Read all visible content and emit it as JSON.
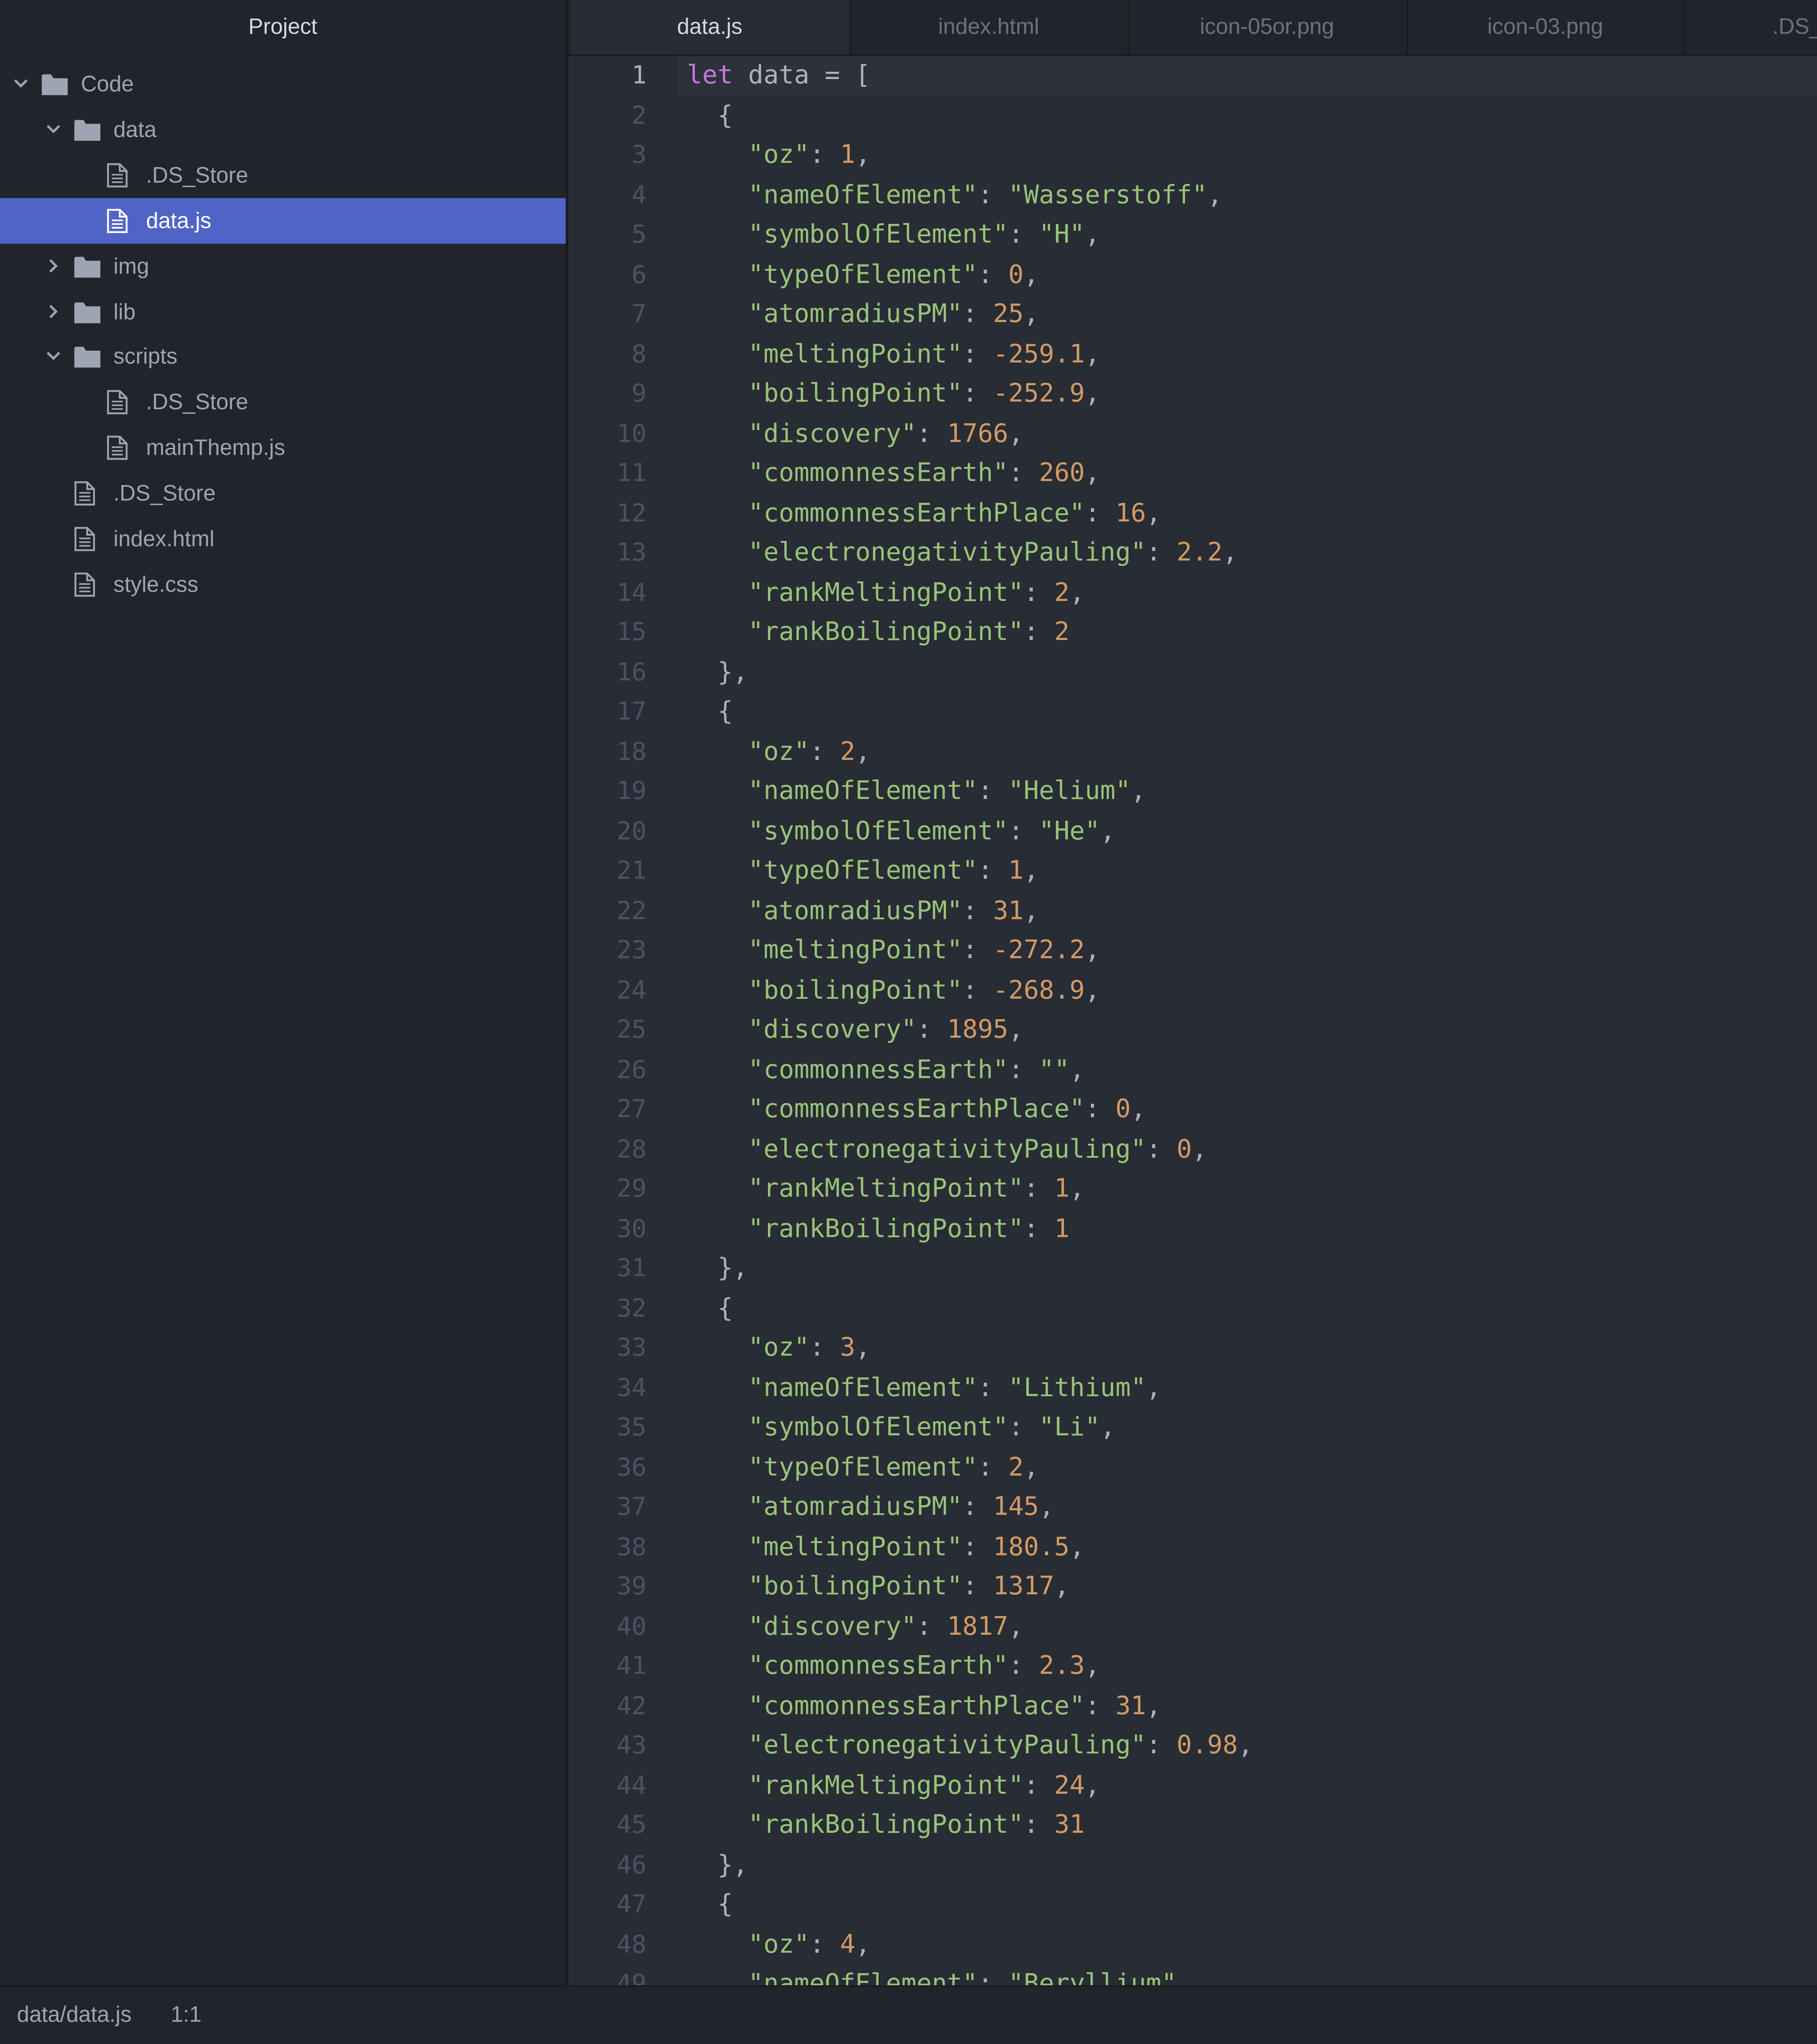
{
  "sidebar": {
    "title": "Project",
    "items": [
      {
        "label": "Code",
        "type": "folder",
        "depth": 0,
        "expanded": true,
        "selected": false
      },
      {
        "label": "data",
        "type": "folder",
        "depth": 1,
        "expanded": true,
        "selected": false
      },
      {
        "label": ".DS_Store",
        "type": "file",
        "depth": 2,
        "selected": false
      },
      {
        "label": "data.js",
        "type": "file",
        "depth": 2,
        "selected": true
      },
      {
        "label": "img",
        "type": "folder",
        "depth": 1,
        "expanded": false,
        "selected": false
      },
      {
        "label": "lib",
        "type": "folder",
        "depth": 1,
        "expanded": false,
        "selected": false
      },
      {
        "label": "scripts",
        "type": "folder",
        "depth": 1,
        "expanded": true,
        "selected": false
      },
      {
        "label": ".DS_Store",
        "type": "file",
        "depth": 2,
        "selected": false
      },
      {
        "label": "mainThemp.js",
        "type": "file",
        "depth": 2,
        "selected": false
      },
      {
        "label": ".DS_Store",
        "type": "file",
        "depth": 1,
        "selected": false
      },
      {
        "label": "index.html",
        "type": "file",
        "depth": 1,
        "selected": false
      },
      {
        "label": "style.css",
        "type": "file",
        "depth": 1,
        "selected": false
      }
    ]
  },
  "tabs": [
    {
      "label": "data.js",
      "active": true
    },
    {
      "label": "index.html",
      "active": false
    },
    {
      "label": "icon-05or.png",
      "active": false
    },
    {
      "label": "icon-03.png",
      "active": false
    },
    {
      "label": ".DS_Store",
      "active": false
    }
  ],
  "editor": {
    "current_line": 1,
    "lines": [
      "let data = [",
      "  {",
      "    \"oz\": 1,",
      "    \"nameOfElement\": \"Wasserstoff\",",
      "    \"symbolOfElement\": \"H\",",
      "    \"typeOfElement\": 0,",
      "    \"atomradiusPM\": 25,",
      "    \"meltingPoint\": -259.1,",
      "    \"boilingPoint\": -252.9,",
      "    \"discovery\": 1766,",
      "    \"commonnessEarth\": 260,",
      "    \"commonnessEarthPlace\": 16,",
      "    \"electronegativityPauling\": 2.2,",
      "    \"rankMeltingPoint\": 2,",
      "    \"rankBoilingPoint\": 2",
      "  },",
      "  {",
      "    \"oz\": 2,",
      "    \"nameOfElement\": \"Helium\",",
      "    \"symbolOfElement\": \"He\",",
      "    \"typeOfElement\": 1,",
      "    \"atomradiusPM\": 31,",
      "    \"meltingPoint\": -272.2,",
      "    \"boilingPoint\": -268.9,",
      "    \"discovery\": 1895,",
      "    \"commonnessEarth\": \"\",",
      "    \"commonnessEarthPlace\": 0,",
      "    \"electronegativityPauling\": 0,",
      "    \"rankMeltingPoint\": 1,",
      "    \"rankBoilingPoint\": 1",
      "  },",
      "  {",
      "    \"oz\": 3,",
      "    \"nameOfElement\": \"Lithium\",",
      "    \"symbolOfElement\": \"Li\",",
      "    \"typeOfElement\": 2,",
      "    \"atomradiusPM\": 145,",
      "    \"meltingPoint\": 180.5,",
      "    \"boilingPoint\": 1317,",
      "    \"discovery\": 1817,",
      "    \"commonnessEarth\": 2.3,",
      "    \"commonnessEarthPlace\": 31,",
      "    \"electronegativityPauling\": 0.98,",
      "    \"rankMeltingPoint\": 24,",
      "    \"rankBoilingPoint\": 31",
      "  },",
      "  {",
      "    \"oz\": 4,",
      "    \"nameOfElement\": \"Beryllium\","
    ]
  },
  "statusbar": {
    "file_path": "data/data.js",
    "cursor": "1:1"
  },
  "colors": {
    "selection": "#5064c8",
    "keyword": "#c678dd",
    "string": "#98c379",
    "number": "#d19a66"
  }
}
